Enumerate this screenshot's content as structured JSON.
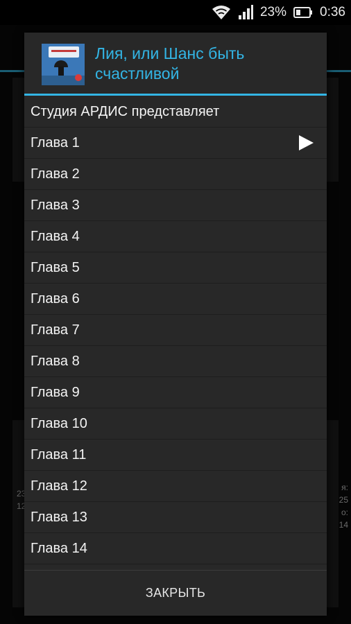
{
  "status_bar": {
    "battery_percent": "23%",
    "time": "0:36",
    "icons": [
      "wifi-icon",
      "signal-icon",
      "battery-icon"
    ]
  },
  "background": {
    "left_text": [
      "23",
      "12"
    ],
    "right_text": [
      "я:",
      "25",
      "о:",
      "14"
    ]
  },
  "dialog": {
    "title": "Лия, или Шанс быть счастливой",
    "accent_color": "#33b5e5",
    "items": [
      {
        "label": "Студия АРДИС представляет",
        "playing": false
      },
      {
        "label": "Глава 1",
        "playing": true
      },
      {
        "label": "Глава 2",
        "playing": false
      },
      {
        "label": "Глава 3",
        "playing": false
      },
      {
        "label": "Глава 4",
        "playing": false
      },
      {
        "label": "Глава 5",
        "playing": false
      },
      {
        "label": "Глава 6",
        "playing": false
      },
      {
        "label": "Глава 7",
        "playing": false
      },
      {
        "label": "Глава 8",
        "playing": false
      },
      {
        "label": "Глава 9",
        "playing": false
      },
      {
        "label": "Глава 10",
        "playing": false
      },
      {
        "label": "Глава 11",
        "playing": false
      },
      {
        "label": "Глава 12",
        "playing": false
      },
      {
        "label": "Глава 13",
        "playing": false
      },
      {
        "label": "Глава 14",
        "playing": false
      }
    ],
    "close_label": "ЗАКРЫТЬ"
  }
}
